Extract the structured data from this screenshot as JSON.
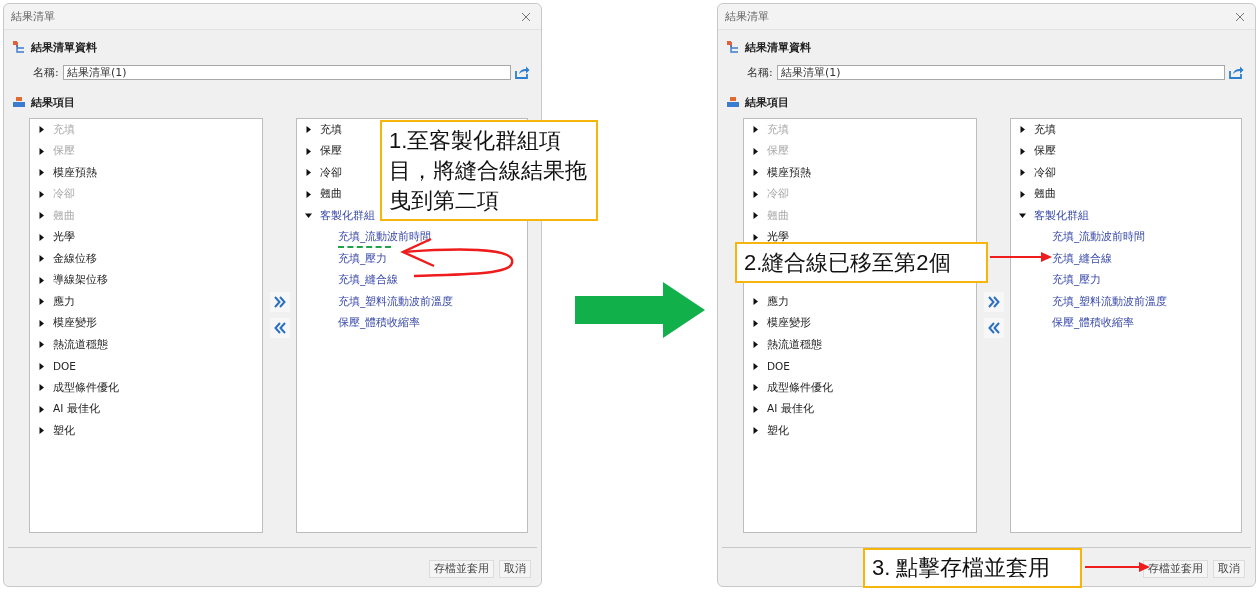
{
  "panels": [
    {
      "title": "結果清單",
      "info_heading": "結果清單資料",
      "name_label": "名稱:",
      "name_value": "結果清單(1)",
      "items_heading": "結果項目",
      "available": [
        {
          "label": "充填",
          "disabled": true,
          "expanded": false
        },
        {
          "label": "保壓",
          "disabled": true,
          "expanded": false
        },
        {
          "label": "模座預熱",
          "disabled": false,
          "expanded": false
        },
        {
          "label": "冷卻",
          "disabled": true,
          "expanded": false
        },
        {
          "label": "翹曲",
          "disabled": true,
          "expanded": false
        },
        {
          "label": "光學",
          "disabled": false,
          "expanded": false
        },
        {
          "label": "金線位移",
          "disabled": false,
          "expanded": false
        },
        {
          "label": "導線架位移",
          "disabled": false,
          "expanded": false
        },
        {
          "label": "應力",
          "disabled": false,
          "expanded": false
        },
        {
          "label": "模座變形",
          "disabled": false,
          "expanded": false
        },
        {
          "label": "熱流道穩態",
          "disabled": false,
          "expanded": false
        },
        {
          "label": "DOE",
          "disabled": false,
          "expanded": false
        },
        {
          "label": "成型條件優化",
          "disabled": false,
          "expanded": false
        },
        {
          "label": "AI 最佳化",
          "disabled": false,
          "expanded": false
        },
        {
          "label": "塑化",
          "disabled": false,
          "expanded": false
        }
      ],
      "chosen": [
        {
          "label": "充填",
          "kind": "category",
          "expanded": false
        },
        {
          "label": "保壓",
          "kind": "category",
          "expanded": false
        },
        {
          "label": "冷卻",
          "kind": "category",
          "expanded": false
        },
        {
          "label": "翹曲",
          "kind": "category",
          "expanded": false
        },
        {
          "label": "客製化群組",
          "kind": "custom-group",
          "expanded": true,
          "children": [
            {
              "label": "充填_流動波前時間",
              "drop_before": false
            },
            {
              "label": "充填_壓力",
              "drop_before": true
            },
            {
              "label": "充填_縫合線",
              "drop_before": false
            },
            {
              "label": "充填_塑料流動波前溫度",
              "drop_before": false
            },
            {
              "label": "保壓_體積收縮率",
              "drop_before": false
            }
          ]
        }
      ],
      "buttons": [
        "存檔並套用",
        "取消"
      ]
    },
    {
      "title": "結果清單",
      "info_heading": "結果清單資料",
      "name_label": "名稱:",
      "name_value": "結果清單(1)",
      "items_heading": "結果項目",
      "available": [
        {
          "label": "充填",
          "disabled": true,
          "expanded": false
        },
        {
          "label": "保壓",
          "disabled": true,
          "expanded": false
        },
        {
          "label": "模座預熱",
          "disabled": false,
          "expanded": false
        },
        {
          "label": "冷卻",
          "disabled": true,
          "expanded": false
        },
        {
          "label": "翹曲",
          "disabled": true,
          "expanded": false
        },
        {
          "label": "光學",
          "disabled": false,
          "expanded": false
        },
        {
          "kind": "covered"
        },
        {
          "kind": "covered"
        },
        {
          "label": "應力",
          "disabled": false,
          "expanded": false
        },
        {
          "label": "模座變形",
          "disabled": false,
          "expanded": false
        },
        {
          "label": "熱流道穩態",
          "disabled": false,
          "expanded": false
        },
        {
          "label": "DOE",
          "disabled": false,
          "expanded": false
        },
        {
          "label": "成型條件優化",
          "disabled": false,
          "expanded": false
        },
        {
          "label": "AI 最佳化",
          "disabled": false,
          "expanded": false
        },
        {
          "label": "塑化",
          "disabled": false,
          "expanded": false
        }
      ],
      "chosen": [
        {
          "label": "充填",
          "kind": "category",
          "expanded": false
        },
        {
          "label": "保壓",
          "kind": "category",
          "expanded": false
        },
        {
          "label": "冷卻",
          "kind": "category",
          "expanded": false
        },
        {
          "label": "翹曲",
          "kind": "category",
          "expanded": false
        },
        {
          "label": "客製化群組",
          "kind": "custom-group",
          "expanded": true,
          "children": [
            {
              "label": "充填_流動波前時間",
              "drop_before": false
            },
            {
              "label": "充填_縫合線",
              "drop_before": false
            },
            {
              "label": "充填_壓力",
              "drop_before": false
            },
            {
              "label": "充填_塑料流動波前溫度",
              "drop_before": false
            },
            {
              "label": "保壓_體積收縮率",
              "drop_before": false
            }
          ]
        }
      ],
      "buttons": [
        "存檔並套用",
        "取消"
      ]
    }
  ],
  "annotations": [
    {
      "kind": "note",
      "text": "1.至客製化群組項目，將縫合線結果拖曳到第二項"
    },
    {
      "kind": "curved-arrow"
    },
    {
      "kind": "note",
      "text": "2.縫合線已移至第2個"
    },
    {
      "kind": "arrow"
    },
    {
      "kind": "note",
      "text": "3. 點擊存檔並套用"
    },
    {
      "kind": "arrow"
    }
  ]
}
